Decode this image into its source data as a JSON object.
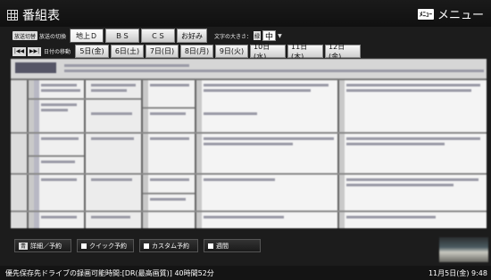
{
  "header": {
    "title": "番組表",
    "menu_icon_text": "ﾒﾆｭｰ",
    "menu_label": "メニュー"
  },
  "broadcast": {
    "switch_key": "放送切替",
    "switch_label": "放送の切換",
    "tabs": [
      {
        "label": "地上Ｄ",
        "active": true
      },
      {
        "label": "ＢＳ",
        "active": false
      },
      {
        "label": "ＣＳ",
        "active": false
      },
      {
        "label": "お好み",
        "active": false
      }
    ],
    "font_size_label": "文字の大きさ：",
    "font_size_key": "緑",
    "font_size_value": "中",
    "font_size_arrow": "▼"
  },
  "date_nav": {
    "prev_icon": "|◀◀",
    "next_icon": "▶▶|",
    "label": "日付の移動",
    "dates": [
      "5日(金)",
      "6日(土)",
      "7日(日)",
      "8日(月)",
      "9日(火)",
      "10日(水)",
      "11日(木)",
      "12日(金)"
    ]
  },
  "buttons": {
    "detail_icon": "青",
    "detail": "詳細／予約",
    "quick": "クイック予約",
    "custom": "カスタム予約",
    "weekly": "週間"
  },
  "status": {
    "left": "優先保存先ドライブの録画可能時間:[DR(最高画質)] 40時間52分",
    "right": "11月5日(金) 9:48"
  },
  "colors": {
    "background": "#1c1c1c",
    "guide_bg": "#eeeeee",
    "accent_blue": "#556677"
  }
}
